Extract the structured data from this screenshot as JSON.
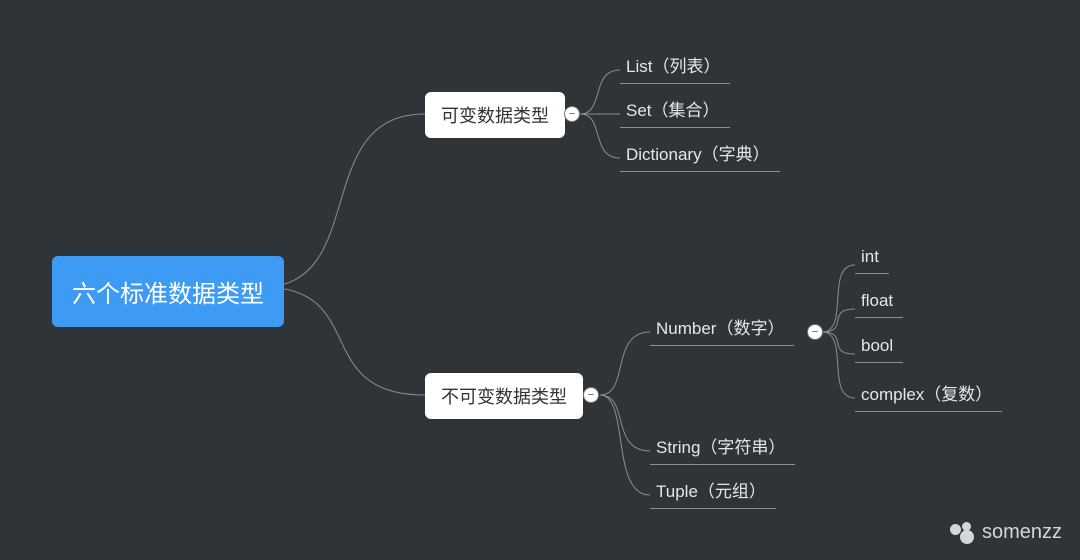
{
  "root": {
    "label": "六个标准数据类型"
  },
  "branches": {
    "mutable": {
      "label": "可变数据类型",
      "children": [
        "List（列表）",
        "Set（集合）",
        "Dictionary（字典）"
      ]
    },
    "immutable": {
      "label": "不可变数据类型",
      "children": [
        "Number（数字）",
        "String（字符串）",
        "Tuple（元组）"
      ],
      "number_sub": [
        "int",
        "float",
        "bool",
        "complex（复数）"
      ]
    }
  },
  "toggle_symbol": "−",
  "watermark": "somenzz",
  "colors": {
    "bg": "#2f3439",
    "root_bg": "#3e9bf4",
    "line": "#8a8d91",
    "leaf_text": "#e6e6e6"
  }
}
